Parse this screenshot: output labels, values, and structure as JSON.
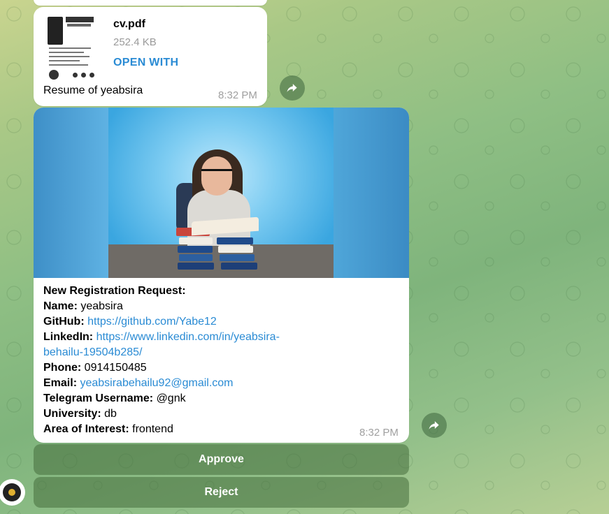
{
  "colors": {
    "link": "#2a8bd4",
    "bubble": "#ffffff",
    "keyboard_button": "#5f8f52",
    "timestamp": "#a0a0a0"
  },
  "document_message": {
    "file_name": "cv.pdf",
    "file_size": "252.4 KB",
    "open_label": "OPEN WITH",
    "caption": "Resume of yeabsira",
    "time": "8:32 PM",
    "thumbnail_icon": "resume-thumbnail"
  },
  "registration_message": {
    "image_icon": "woman-reading-books-photo",
    "heading": "New Registration Request:",
    "fields": {
      "name_label": "Name:",
      "name_value": "yeabsira",
      "github_label": "GitHub:",
      "github_value": "https://github.com/Yabe12",
      "linkedin_label": "LinkedIn:",
      "linkedin_value_line1": "https://www.linkedin.com/in/yeabsira-",
      "linkedin_value_line2": "behailu-19504b285/",
      "phone_label": "Phone:",
      "phone_value": "0914150485",
      "email_label": "Email:",
      "email_value": "yeabsirabehailu92@gmail.com",
      "telegram_label": "Telegram Username:",
      "telegram_value": "@gnk",
      "university_label": "University:",
      "university_value": "db",
      "interest_label": "Area of Interest:",
      "interest_value": "frontend"
    },
    "time": "8:32 PM"
  },
  "keyboard": {
    "approve_label": "Approve",
    "reject_label": "Reject"
  },
  "icons": {
    "forward": "forward-arrow-icon",
    "avatar": "bot-avatar"
  }
}
